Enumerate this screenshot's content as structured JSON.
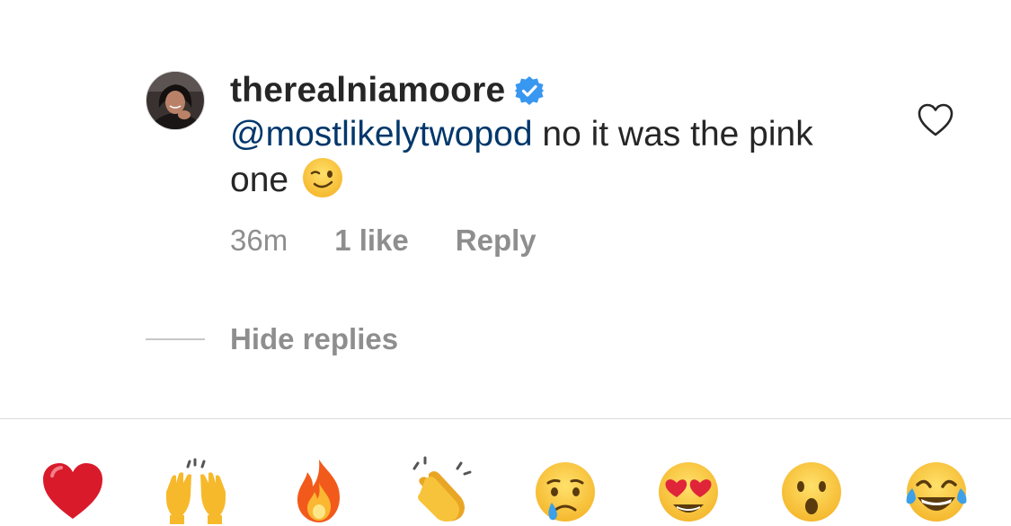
{
  "comment": {
    "username": "therealniamoore",
    "verified": true,
    "mention": "@mostlikelytwopod",
    "text": " no it was the pink one",
    "emoji": "winking-face",
    "timestamp": "36m",
    "likes": "1 like",
    "reply_label": "Reply"
  },
  "replies": {
    "toggle_label": "Hide replies"
  },
  "reaction_bar": {
    "emojis": [
      "red-heart",
      "raising-hands",
      "fire",
      "clapping-hands",
      "crying-face",
      "heart-eyes-face",
      "astonished-face",
      "tears-of-joy-face"
    ]
  },
  "colors": {
    "text": "#262626",
    "secondary": "#8e8e8e",
    "mention": "#00376b",
    "verified": "#3897f0",
    "divider": "#dbdbdb"
  }
}
